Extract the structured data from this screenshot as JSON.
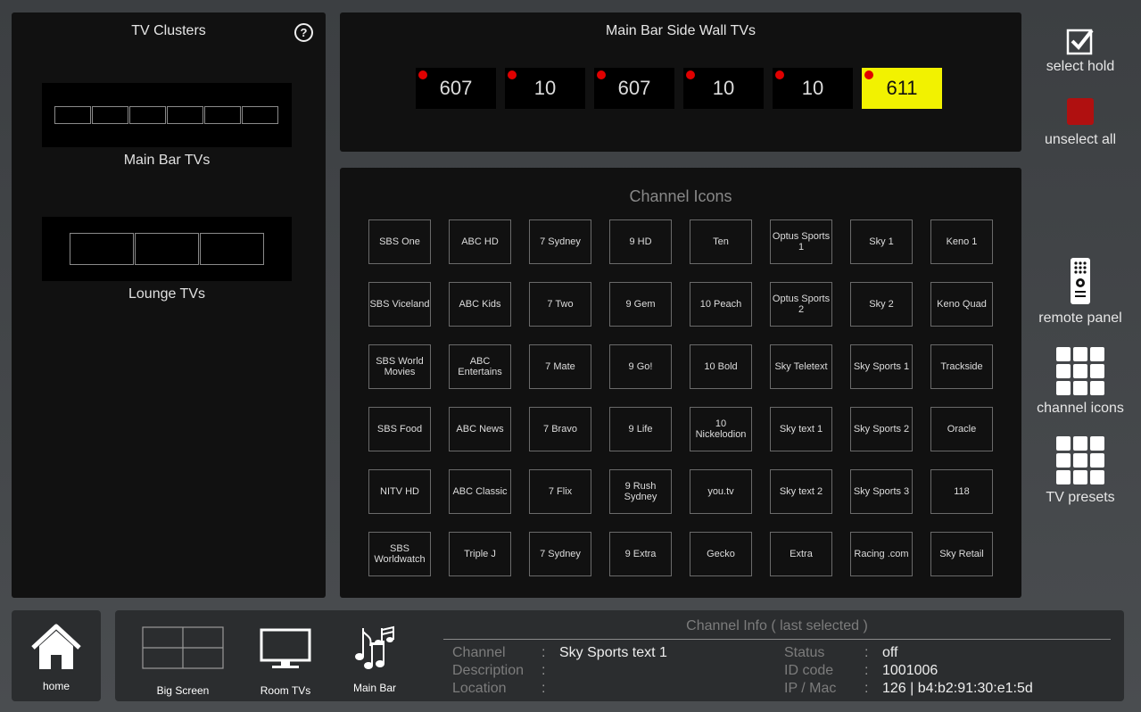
{
  "clusters": {
    "title": "TV Clusters",
    "help_glyph": "?",
    "items": [
      {
        "label": "Main Bar TVs"
      },
      {
        "label": "Lounge TVs"
      }
    ]
  },
  "tvbar": {
    "title": "Main Bar Side Wall TVs",
    "tvs": [
      {
        "channel": "607",
        "selected": false
      },
      {
        "channel": "10",
        "selected": false
      },
      {
        "channel": "607",
        "selected": false
      },
      {
        "channel": "10",
        "selected": false
      },
      {
        "channel": "10",
        "selected": false
      },
      {
        "channel": "611",
        "selected": true
      }
    ],
    "status_color": "#e00000",
    "selected_color": "#f2f200"
  },
  "channels": {
    "title": "Channel Icons",
    "grid": [
      [
        "SBS One",
        "ABC HD",
        "7 Sydney",
        "9 HD",
        "Ten",
        "Optus Sports 1",
        "Sky 1",
        "Keno 1"
      ],
      [
        "SBS Viceland",
        "ABC Kids",
        "7 Two",
        "9 Gem",
        "10 Peach",
        "Optus Sports 2",
        "Sky 2",
        "Keno Quad"
      ],
      [
        "SBS World Movies",
        "ABC Entertains",
        "7 Mate",
        "9 Go!",
        "10 Bold",
        "Sky Teletext",
        "Sky Sports 1",
        "Trackside"
      ],
      [
        "SBS Food",
        "ABC News",
        "7 Bravo",
        "9 Life",
        "10 Nickelodion",
        "Sky text 1",
        "Sky Sports 2",
        "Oracle"
      ],
      [
        "NITV HD",
        "ABC Classic",
        "7 Flix",
        "9 Rush Sydney",
        "you.tv",
        "Sky text 2",
        "Sky Sports 3",
        "118"
      ],
      [
        "SBS Worldwatch",
        "Triple J",
        "7 Sydney",
        "9 Extra",
        "Gecko",
        "Extra",
        "Racing .com",
        "Sky Retail"
      ]
    ]
  },
  "side": {
    "select_hold": "select hold",
    "unselect_all": "unselect all",
    "remote_panel": "remote panel",
    "channel_icons": "channel icons",
    "tv_presets": "TV presets",
    "unselect_color": "#b01010"
  },
  "nav": {
    "home": "home",
    "big_screen": "Big Screen",
    "room_tvs": "Room TVs",
    "main_bar": "Main Bar"
  },
  "info": {
    "title": "Channel Info ( last selected )",
    "channel_label": "Channel",
    "description_label": "Description",
    "location_label": "Location",
    "status_label": "Status",
    "id_label": "ID code",
    "ip_label": "IP / Mac",
    "colon": ":",
    "channel": "Sky Sports text 1",
    "description": "",
    "location": "",
    "status": "off",
    "id_code": "1001006",
    "ip_mac": "126 | b4:b2:91:30:e1:5d"
  }
}
